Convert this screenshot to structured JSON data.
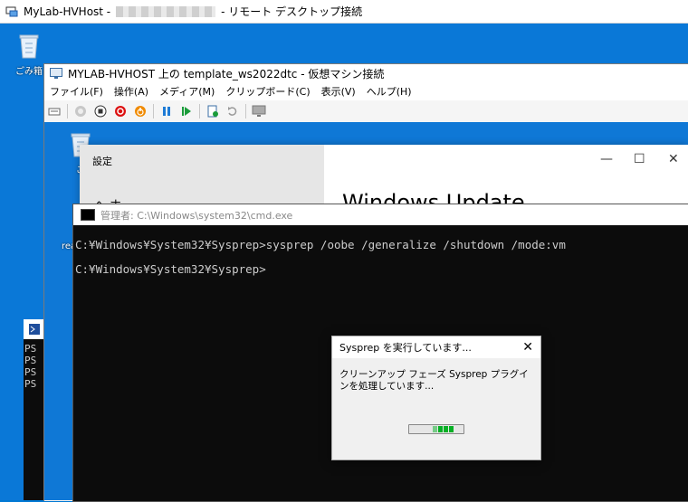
{
  "rdp": {
    "title_host": "MyLab-HVHost -",
    "title_suffix": "- リモート デスクトップ接続"
  },
  "remote_desktop": {
    "recycle_label": "ごみ箱"
  },
  "vm_window": {
    "title": "MYLAB-HVHOST 上の template_ws2022dtc - 仮想マシン接続",
    "menu": [
      "ファイル(F)",
      "操作(A)",
      "メディア(M)",
      "クリップボード(C)",
      "表示(V)",
      "ヘルプ(H)"
    ]
  },
  "guest": {
    "recycle_label": "ご",
    "truncated_label": "rea",
    "ps_lines": [
      "PS",
      "PS",
      "PS",
      "PS"
    ]
  },
  "settings": {
    "title": "設定",
    "left_partial": "へ ホ",
    "heading": "Windows Update",
    "controls": [
      "—",
      "☐",
      "✕"
    ]
  },
  "cmd": {
    "title": "管理者: C:\\Windows\\system32\\cmd.exe",
    "lines": [
      "C:¥Windows¥System32¥Sysprep>sysprep /oobe /generalize /shutdown /mode:vm",
      "C:¥Windows¥System32¥Sysprep>"
    ]
  },
  "sysprep": {
    "title": "Sysprep を実行しています...",
    "message": "クリーンアップ フェーズ Sysprep プラグインを処理しています...",
    "progress": "indeterminate"
  },
  "colors": {
    "desktop": "#0078d4",
    "cmd_bg": "#0c0c0c",
    "progress": "#06b025"
  }
}
